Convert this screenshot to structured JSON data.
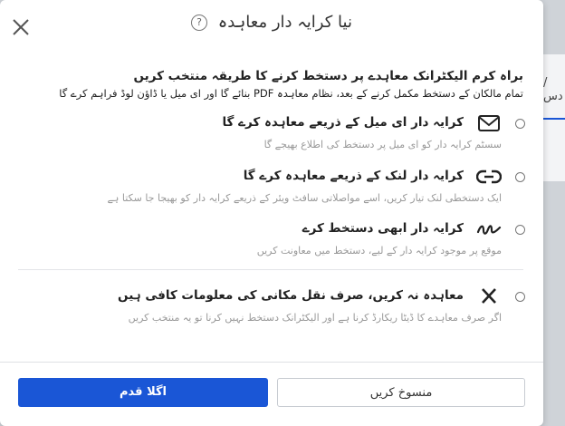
{
  "background": {
    "partial_text": "/دس"
  },
  "dialog": {
    "title": "نیا کرایہ دار معاہدہ",
    "help_glyph": "?",
    "intro_heading": "براہ کرم الیکٹرانک معاہدے پر دستخط کرنے کا طریقہ منتخب کریں",
    "intro_sub": "تمام مالکان کے دستخط مکمل کرنے کے بعد، نظام معاہدہ PDF بنائے گا اور ای میل یا ڈاؤن لوڈ فراہم کرے گا",
    "options": [
      {
        "icon": "envelope-icon",
        "label": "کرایہ دار ای میل کے ذریعے معاہدہ کرے گا",
        "description": "سسٹم کرایہ دار کو ای میل پر دستخط کی اطلاع بھیجے گا"
      },
      {
        "icon": "link-icon",
        "label": "کرایہ دار لنک کے ذریعے معاہدہ کرے گا",
        "description": "ایک دستخطی لنک تیار کریں، اسے مواصلاتی سافٹ ویئر کے ذریعے کرایہ دار کو بھیجا جا سکتا ہے"
      },
      {
        "icon": "signature-icon",
        "label": "کرایہ دار ابھی دستخط کرے",
        "description": "موقع پر موجود کرایہ دار کے لیے، دستخط میں معاونت کریں"
      },
      {
        "icon": "x-mark-icon",
        "label": "معاہدہ نہ کریں، صرف نقل مکانی کی معلومات کافی ہیں",
        "description": "اگر صرف معاہدے کا ڈیٹا ریکارڈ کرنا ہے اور الیکٹرانک دستخط نہیں کرنا تو یہ منتخب کریں"
      }
    ],
    "next_label": "اگلا قدم",
    "cancel_label": "منسوخ کریں"
  },
  "colors": {
    "primary": "#1a56d6",
    "muted_text": "#999999"
  }
}
